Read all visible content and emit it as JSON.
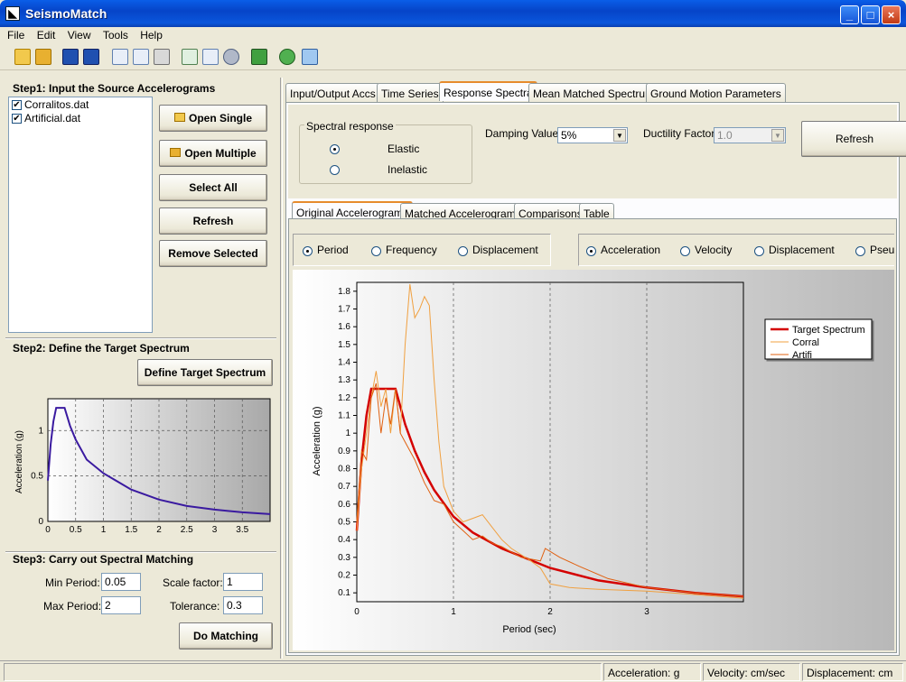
{
  "window": {
    "title": "SeismoMatch",
    "minimize": "_",
    "maximize": "□",
    "close": "×"
  },
  "menu": [
    "File",
    "Edit",
    "View",
    "Tools",
    "Help"
  ],
  "step1": {
    "header": "Step1: Input the Source Accelerograms",
    "files": [
      {
        "name": "Corralitos.dat",
        "checked": "✔"
      },
      {
        "name": "Artificial.dat",
        "checked": "✔"
      }
    ],
    "buttons": {
      "open_single": "Open Single",
      "open_multiple": "Open Multiple",
      "select_all": "Select All",
      "refresh": "Refresh",
      "remove_selected": "Remove Selected"
    }
  },
  "step2": {
    "header": "Step2: Define the Target Spectrum",
    "define_button": "Define Target Spectrum",
    "mini_chart": {
      "ylabel": "Acceleration (g)",
      "yticks": [
        "1",
        "0.5",
        "0"
      ],
      "xticks": [
        "0",
        "0.5",
        "1",
        "1.5",
        "2",
        "2.5",
        "3",
        "3.5"
      ]
    }
  },
  "step3": {
    "header": "Step3: Carry out Spectral Matching",
    "min_period_label": "Min Period:",
    "min_period": "0.05",
    "max_period_label": "Max Period:",
    "max_period": "2",
    "scale_factor_label": "Scale factor:",
    "scale_factor": "1",
    "tolerance_label": "Tolerance:",
    "tolerance": "0.3",
    "do_matching": "Do Matching"
  },
  "main_tabs": [
    "Input/Output Accs",
    "Time Series",
    "Response Spectra",
    "Mean Matched Spectrum",
    "Ground Motion Parameters"
  ],
  "spectral": {
    "group_label": "Spectral response",
    "elastic": "Elastic",
    "inelastic": "Inelastic",
    "damping_label": "Damping Value",
    "damping_value": "5%",
    "ductility_label": "Ductility Factor",
    "ductility_value": "1.0",
    "refresh": "Refresh"
  },
  "sub_tabs": [
    "Original Accelerograms",
    "Matched Accelerograms",
    "Comparisons",
    "Table"
  ],
  "axis_options": {
    "x": [
      "Period",
      "Frequency",
      "Displacement"
    ],
    "y": [
      "Acceleration",
      "Velocity",
      "Displacement",
      "Pseu"
    ]
  },
  "chart_data": {
    "type": "line",
    "xlabel": "Period (sec)",
    "ylabel": "Acceleration (g)",
    "xlim": [
      0,
      4
    ],
    "ylim": [
      0.05,
      1.85
    ],
    "xticks": [
      "0",
      "1",
      "2",
      "3"
    ],
    "yticks": [
      "1.8",
      "1.7",
      "1.6",
      "1.5",
      "1.4",
      "1.3",
      "1.2",
      "1.1",
      "1",
      "0.9",
      "0.8",
      "0.7",
      "0.6",
      "0.5",
      "0.4",
      "0.3",
      "0.2",
      "0.1"
    ],
    "grid": "dashed vertical",
    "legend_position": "top-right",
    "series": [
      {
        "name": "Target Spectrum",
        "color": "#d40000",
        "x": [
          0,
          0.05,
          0.1,
          0.15,
          0.2,
          0.3,
          0.4,
          0.45,
          0.5,
          0.6,
          0.7,
          0.8,
          1,
          1.2,
          1.5,
          2,
          2.5,
          3,
          3.5,
          4
        ],
        "y": [
          0.45,
          0.85,
          1.1,
          1.25,
          1.25,
          1.25,
          1.25,
          1.15,
          1.05,
          0.9,
          0.78,
          0.68,
          0.53,
          0.44,
          0.35,
          0.24,
          0.17,
          0.13,
          0.1,
          0.08
        ]
      },
      {
        "name": "Corral",
        "color": "#f0a040",
        "x": [
          0,
          0.05,
          0.1,
          0.15,
          0.2,
          0.25,
          0.3,
          0.35,
          0.4,
          0.45,
          0.5,
          0.55,
          0.6,
          0.65,
          0.7,
          0.75,
          0.8,
          0.85,
          0.9,
          1,
          1.1,
          1.2,
          1.3,
          1.4,
          1.5,
          1.6,
          1.8,
          1.9,
          2,
          2.2,
          2.5,
          3,
          3.5,
          4
        ],
        "y": [
          0.45,
          0.8,
          1.0,
          1.2,
          1.35,
          1.15,
          1.25,
          1.0,
          1.25,
          1.0,
          1.5,
          1.84,
          1.65,
          1.7,
          1.77,
          1.72,
          1.3,
          0.95,
          0.7,
          0.56,
          0.5,
          0.52,
          0.54,
          0.47,
          0.4,
          0.35,
          0.28,
          0.24,
          0.15,
          0.13,
          0.12,
          0.11,
          0.09,
          0.07
        ]
      },
      {
        "name": "Artifi",
        "color": "#e06010",
        "x": [
          0,
          0.05,
          0.1,
          0.15,
          0.2,
          0.25,
          0.3,
          0.35,
          0.4,
          0.45,
          0.5,
          0.6,
          0.7,
          0.8,
          0.9,
          1,
          1.1,
          1.2,
          1.3,
          1.4,
          1.5,
          1.7,
          1.9,
          1.95,
          2.1,
          2.3,
          2.6,
          3,
          3.5,
          4
        ],
        "y": [
          0.5,
          0.9,
          0.85,
          1.2,
          1.28,
          1.0,
          1.2,
          1.05,
          1.25,
          1.0,
          0.95,
          0.85,
          0.72,
          0.62,
          0.6,
          0.5,
          0.45,
          0.4,
          0.42,
          0.38,
          0.36,
          0.3,
          0.28,
          0.35,
          0.3,
          0.25,
          0.18,
          0.13,
          0.1,
          0.08
        ]
      }
    ]
  },
  "mini_chart_data": {
    "type": "line",
    "xlim": [
      0,
      4
    ],
    "ylim": [
      0,
      1.35
    ],
    "series": [
      {
        "color": "#3a1aa0",
        "x": [
          0,
          0.05,
          0.1,
          0.15,
          0.3,
          0.4,
          0.5,
          0.7,
          1,
          1.5,
          2,
          2.5,
          3,
          3.5,
          4
        ],
        "y": [
          0.45,
          0.85,
          1.1,
          1.25,
          1.25,
          1.05,
          0.9,
          0.68,
          0.53,
          0.35,
          0.24,
          0.17,
          0.13,
          0.1,
          0.08
        ]
      }
    ]
  },
  "status": {
    "blank": "",
    "acceleration": "Acceleration: g",
    "velocity": "Velocity: cm/sec",
    "displacement": "Displacement: cm"
  }
}
